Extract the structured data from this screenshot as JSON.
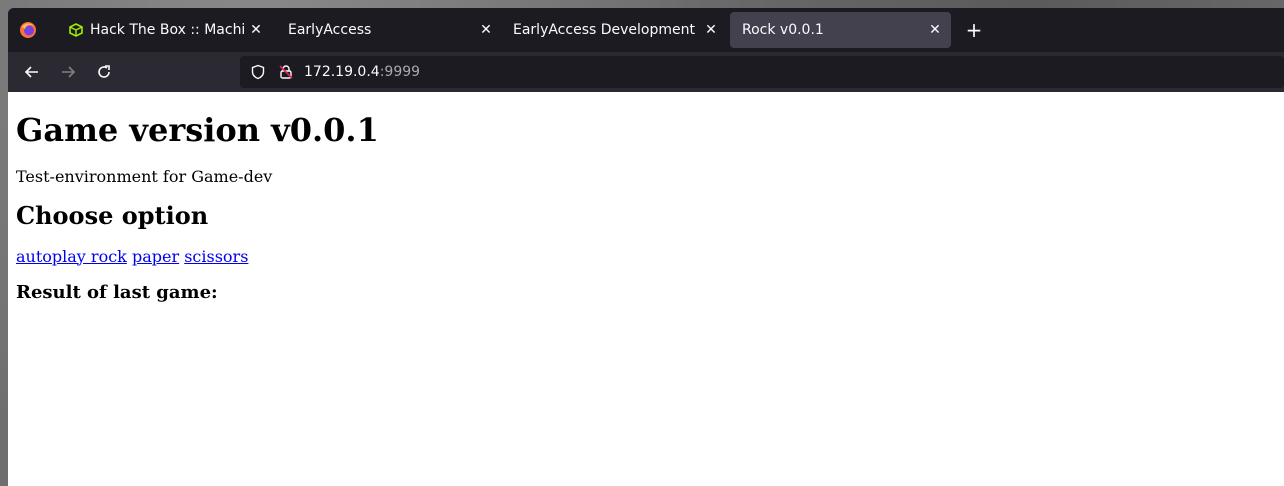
{
  "browser": {
    "tabs": [
      {
        "label": "Hack The Box :: Machines",
        "icon": "htb-cube-icon",
        "active": false
      },
      {
        "label": "EarlyAccess",
        "active": false
      },
      {
        "label": "EarlyAccess Development",
        "active": false
      },
      {
        "label": "Rock v0.0.1",
        "active": true
      }
    ],
    "close_glyph": "✕",
    "new_tab_glyph": "+",
    "url": {
      "host": "172.19.0.4",
      "port": ":9999"
    }
  },
  "page": {
    "title": "Game version v0.0.1",
    "subtitle": "Test-environment for Game-dev",
    "choose_heading": "Choose option",
    "options": [
      "autoplay rock",
      "paper",
      "scissors"
    ],
    "result_heading": "Result of last game:"
  },
  "colors": {
    "tabstrip_bg": "#1c1b22",
    "navbar_bg": "#2b2a33",
    "active_tab_bg": "#42414d",
    "link": "#0000ee"
  }
}
